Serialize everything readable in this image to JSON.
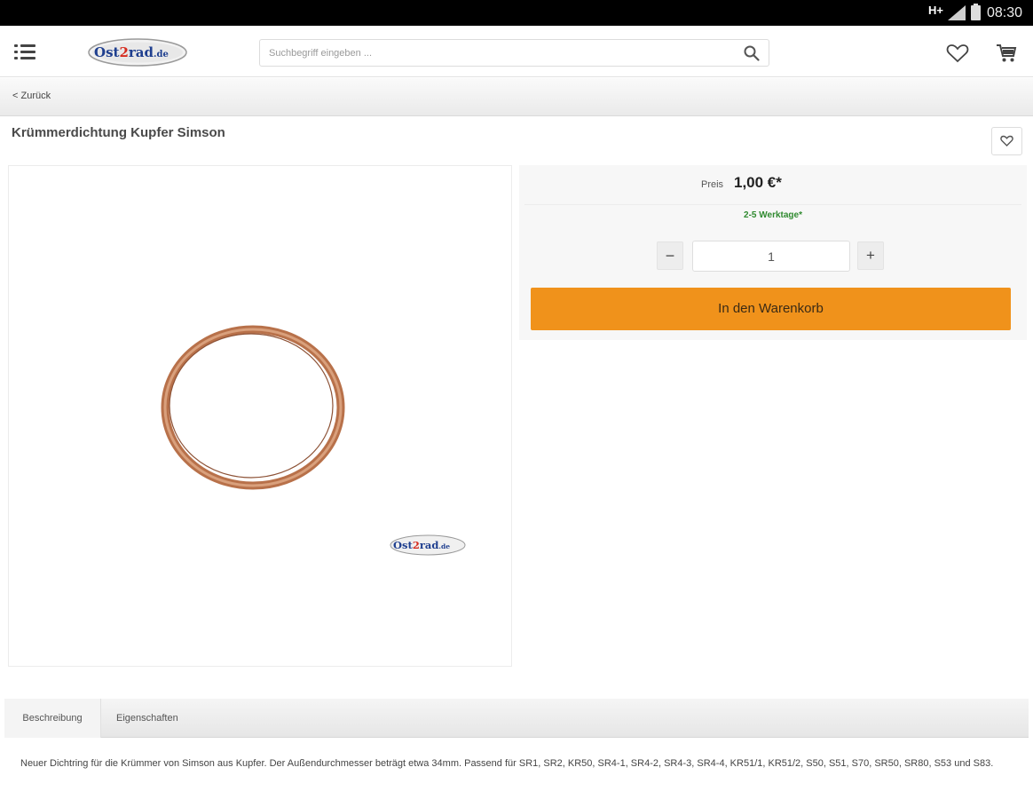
{
  "status_bar": {
    "network": "H+",
    "time": "08:30"
  },
  "header": {
    "logo_text": "Ost2rad.de",
    "search_placeholder": "Suchbegriff eingeben ..."
  },
  "navigation": {
    "back_label": "< Zurück"
  },
  "product": {
    "title": "Krümmerdichtung Kupfer Simson",
    "price_label": "Preis",
    "price": "1,00 €*",
    "delivery": "2-5 Werktage*",
    "quantity": "1",
    "minus_label": "−",
    "plus_label": "+",
    "add_to_cart_label": "In den Warenkorb",
    "watermark_text": "Ost2rad.de"
  },
  "tabs": [
    {
      "label": "Beschreibung"
    },
    {
      "label": "Eigenschaften"
    }
  ],
  "description": "Neuer Dichtring für die Krümmer von Simson aus Kupfer. Der Außendurchmesser beträgt etwa 34mm. Passend für SR1, SR2, KR50, SR4-1, SR4-2, SR4-3, SR4-4, KR51/1, KR51/2, S50, S51, S70, SR50, SR80, S53 und S83.",
  "colors": {
    "accent": "#f0921b",
    "delivery_green": "#2f8a2f",
    "status_bar": "#000000"
  },
  "icons": [
    "menu-icon",
    "search-icon",
    "heart-icon",
    "cart-icon",
    "compare-icon",
    "signal-icon",
    "battery-icon"
  ]
}
